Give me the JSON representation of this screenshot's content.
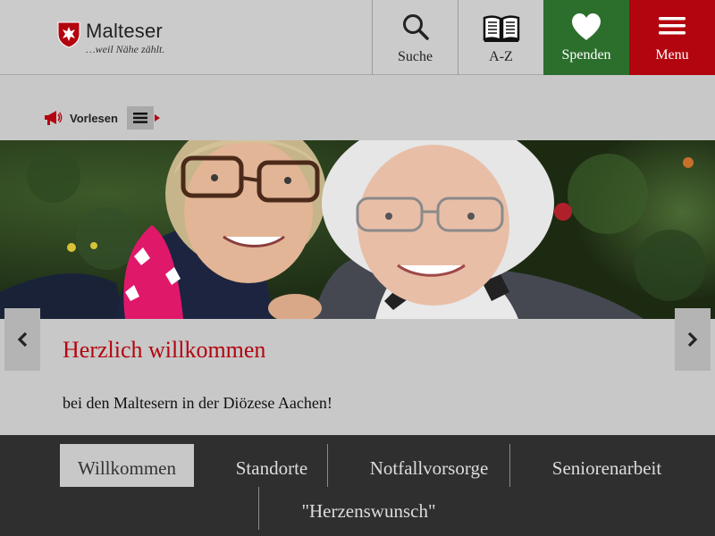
{
  "header": {
    "logo_name": "Malteser",
    "logo_tagline": "…weil Nähe zählt.",
    "search_label": "Suche",
    "az_label": "A-Z",
    "donate_label": "Spenden",
    "menu_label": "Menu"
  },
  "tools": {
    "read_label": "Vorlesen"
  },
  "slide": {
    "title": "Herzlich willkommen",
    "text": "bei den Maltesern in der Diözese Aachen!"
  },
  "bottom_nav": {
    "items": [
      {
        "label": "Willkommen",
        "active": true
      },
      {
        "label": "Standorte"
      },
      {
        "label": "Notfallvorsorge"
      },
      {
        "label": "Seniorenarbeit"
      },
      {
        "label": "\"Herzenswunsch\""
      }
    ]
  },
  "colors": {
    "brand_red": "#b3050f",
    "donate_green": "#2c6f2c",
    "nav_dark": "#2f2f2f",
    "page_bg": "#c8c8c8"
  },
  "icons": [
    "malteser-cross-icon",
    "search-icon",
    "book-icon",
    "heart-icon",
    "hamburger-icon",
    "megaphone-icon",
    "list-icon",
    "chevron-left-icon",
    "chevron-right-icon"
  ]
}
